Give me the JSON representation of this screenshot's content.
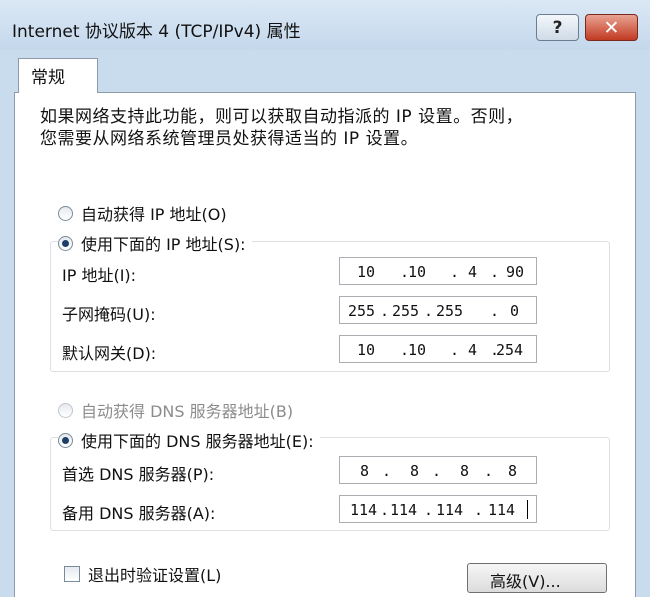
{
  "window": {
    "title": "Internet 协议版本 4 (TCP/IPv4) 属性",
    "help_label": "?",
    "close_label": "✕"
  },
  "tab": {
    "label": "常规"
  },
  "description": {
    "line1": "如果网络支持此功能，则可以获取自动指派的 IP 设置。否则，",
    "line2": "您需要从网络系统管理员处获得适当的 IP 设置。"
  },
  "ip_section": {
    "auto_label": "自动获得 IP 地址(O)",
    "manual_label": "使用下面的 IP 地址(S):",
    "fields": [
      {
        "label": "IP 地址(I):",
        "octets": [
          "10",
          "10",
          "4",
          "90"
        ]
      },
      {
        "label": "子网掩码(U):",
        "octets": [
          "255",
          "255",
          "255",
          "0"
        ]
      },
      {
        "label": "默认网关(D):",
        "octets": [
          "10",
          "10",
          "4",
          "254"
        ]
      }
    ]
  },
  "dns_section": {
    "auto_label": "自动获得 DNS 服务器地址(B)",
    "manual_label": "使用下面的 DNS 服务器地址(E):",
    "fields": [
      {
        "label": "首选 DNS 服务器(P):",
        "octets": [
          "8",
          "8",
          "8",
          "8"
        ]
      },
      {
        "label": "备用 DNS 服务器(A):",
        "octets": [
          "114",
          "114",
          "114",
          "114"
        ]
      }
    ]
  },
  "validate_label": "退出时验证设置(L)",
  "advanced_label": "高级(V)..."
}
